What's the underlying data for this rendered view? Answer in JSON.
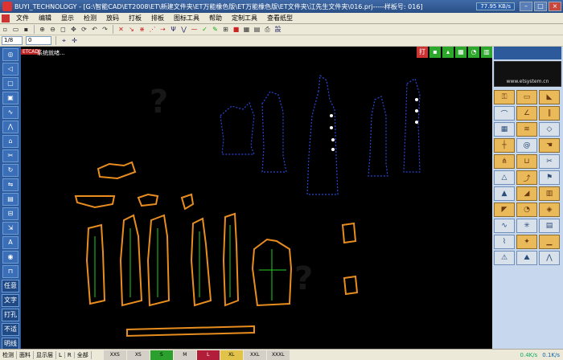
{
  "window": {
    "title": "BUYI_TECHNOLOGY - [G:\\智能CAD\\ET2008\\ET\\新建文件夹\\ET万能橡色版\\ET万能橡色版\\ET文件夹\\江先生文件夹\\016.prj-----样板号: 016]",
    "network_speed": "77.95 KB/s"
  },
  "menu": {
    "items": [
      "文件",
      "编辑",
      "显示",
      "检测",
      "放码",
      "打板",
      "排板",
      "图标工具",
      "帮助",
      "定制工具",
      "查看纸型"
    ]
  },
  "toolbar2": {
    "unit_value": "1/8",
    "number_value": "0"
  },
  "status": {
    "cad_tag": "ETCAD",
    "message": "系统就绪..."
  },
  "snap": {
    "buttons": [
      "打",
      "",
      "",
      "",
      "",
      ""
    ]
  },
  "left_bar": {
    "text_buttons": [
      "任意",
      "文字",
      "打孔",
      "不适",
      "明线"
    ]
  },
  "brand": {
    "url": "www.etsystem.cn"
  },
  "bottom": {
    "tabs": [
      "检测",
      "面料",
      "显示层",
      "L",
      "R",
      "全部"
    ],
    "sizes": [
      {
        "label": "XXS",
        "color": "#d4d0c8"
      },
      {
        "label": "XS",
        "color": "#d4d0c8"
      },
      {
        "label": "S",
        "color": "#2ca02c"
      },
      {
        "label": "M",
        "color": "#d4d0c8"
      },
      {
        "label": "L",
        "color": "#b21e3a"
      },
      {
        "label": "XL",
        "color": "#e2c34a"
      },
      {
        "label": "XXL",
        "color": "#d4d0c8"
      },
      {
        "label": "XXXL",
        "color": "#d4d0c8"
      }
    ],
    "speed_up": "0.4K/s",
    "speed_down": "0.1K/s"
  },
  "colors": {
    "graded_piece": "#e88d1e",
    "outline_piece": "#2848d8",
    "grain_line": "#24d024"
  }
}
